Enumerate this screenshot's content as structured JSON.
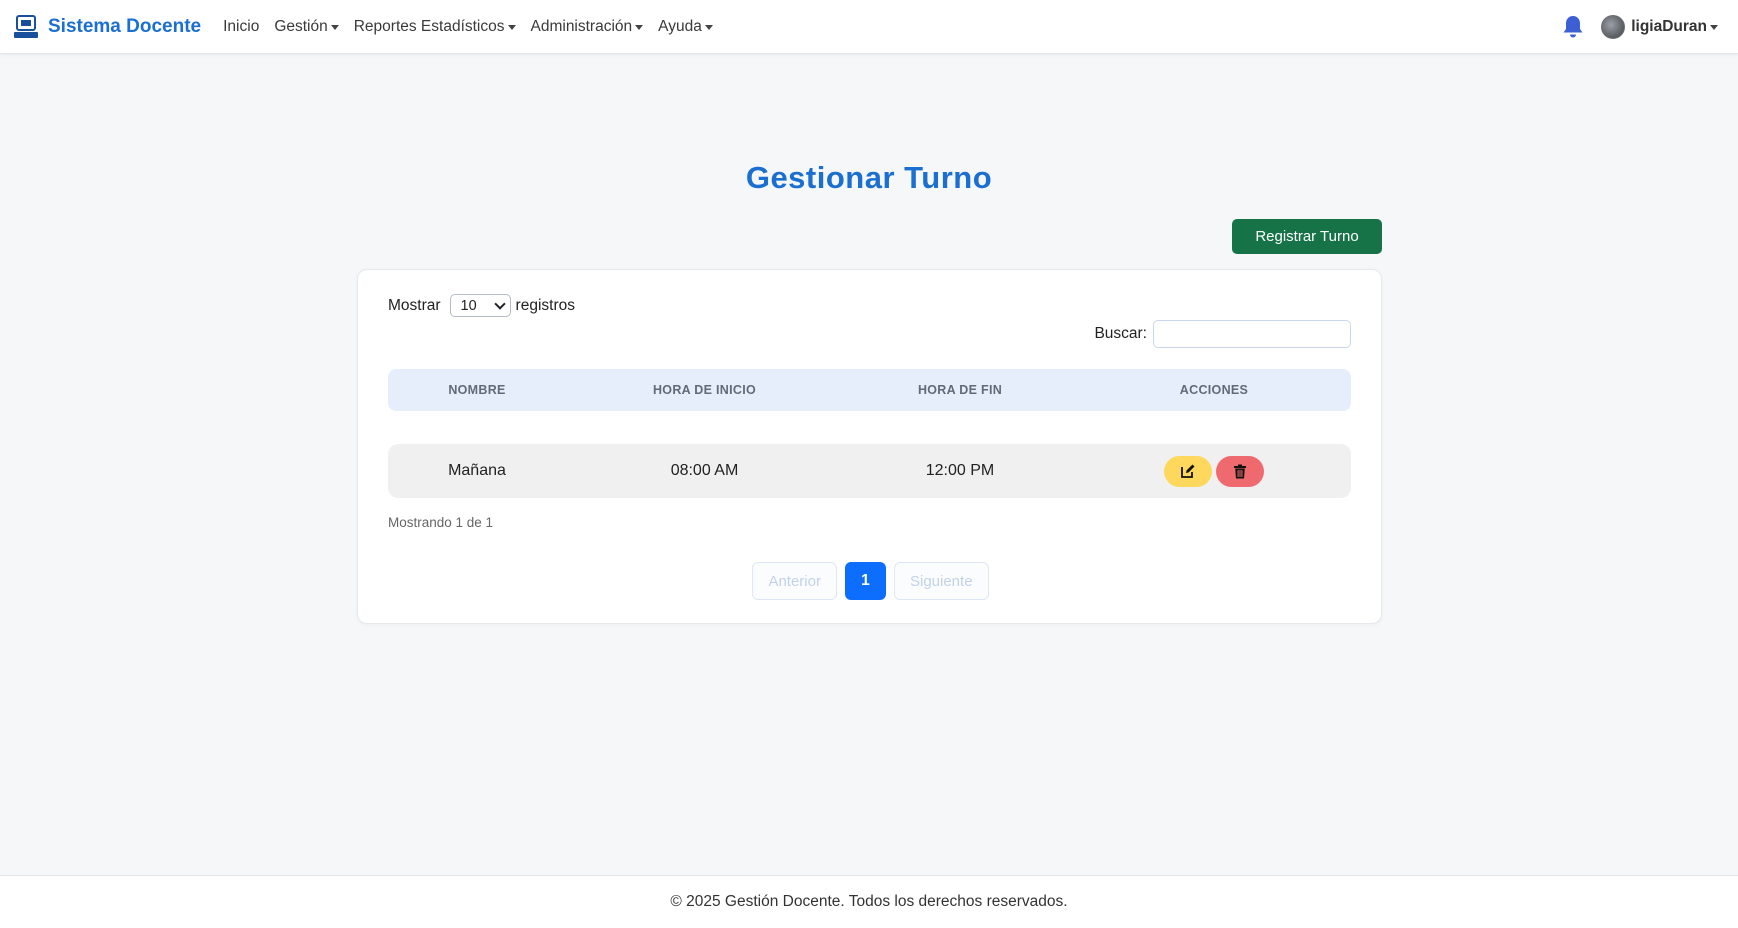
{
  "navbar": {
    "brand": "Sistema Docente",
    "links": [
      {
        "label": "Inicio",
        "dropdown": false
      },
      {
        "label": "Gestión",
        "dropdown": true
      },
      {
        "label": "Reportes Estadísticos",
        "dropdown": true
      },
      {
        "label": "Administración",
        "dropdown": true
      },
      {
        "label": "Ayuda",
        "dropdown": true
      }
    ],
    "user": "ligiaDuran",
    "accent_color": "#1a6fd1"
  },
  "page": {
    "title": "Gestionar Turno",
    "register_button": "Registrar Turno"
  },
  "table_controls": {
    "show_label": "Mostrar",
    "show_value": "10",
    "records_label": "registros",
    "search_label": "Buscar:",
    "search_value": ""
  },
  "table": {
    "columns": [
      "NOMBRE",
      "HORA DE INICIO",
      "HORA DE FIN",
      "ACCIONES"
    ],
    "rows": [
      {
        "nombre": "Mañana",
        "hora_inicio": "08:00 AM",
        "hora_fin": "12:00 PM"
      }
    ]
  },
  "info": "Mostrando 1 de 1",
  "pagination": {
    "prev": "Anterior",
    "current": "1",
    "next": "Siguiente"
  },
  "footer": "© 2025 Gestión Docente. Todos los derechos reservados."
}
